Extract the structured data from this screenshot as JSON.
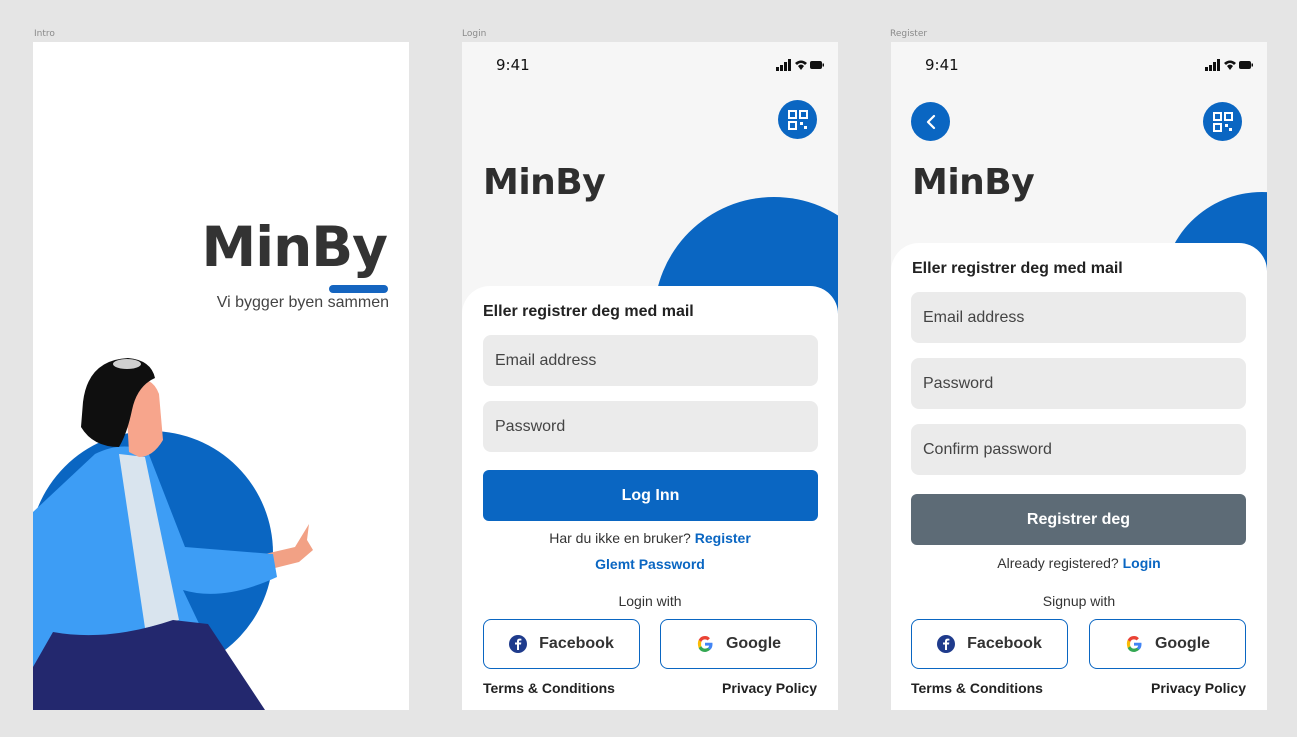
{
  "frames": {
    "intro_label": "Intro",
    "login_label": "Login",
    "register_label": "Register"
  },
  "intro": {
    "title": "MinBy",
    "subtitle": "Vi bygger byen sammen"
  },
  "status": {
    "time": "9:41"
  },
  "login": {
    "app_title": "MinBy",
    "heading": "Eller registrer deg med mail",
    "email_placeholder": "Email address",
    "password_placeholder": "Password",
    "login_button": "Log Inn",
    "no_account_text": "Har du ikke en bruker?",
    "register_link": "Register",
    "forgot_link": "Glemt Password",
    "login_with": "Login with",
    "facebook": "Facebook",
    "google": "Google",
    "terms": "Terms & Conditions",
    "privacy": "Privacy Policy"
  },
  "register": {
    "app_title": "MinBy",
    "heading": "Eller registrer deg med mail",
    "email_placeholder": "Email address",
    "password_placeholder": "Password",
    "confirm_placeholder": "Confirm password",
    "register_button": "Registrer deg",
    "already_text": "Already registered?",
    "login_link": "Login",
    "signup_with": "Signup with",
    "facebook": "Facebook",
    "google": "Google",
    "terms": "Terms & Conditions",
    "privacy": "Privacy Policy"
  },
  "colors": {
    "primary": "#0a66c2",
    "disabled_button": "#5d6b76",
    "facebook": "#1f3b8c",
    "illustration_light_blue": "#3d9df5",
    "illustration_navy": "#23286e"
  },
  "icons": [
    "qr-code-icon",
    "back-arrow-icon",
    "facebook-icon",
    "google-icon",
    "signal-icon",
    "wifi-icon",
    "battery-icon"
  ]
}
